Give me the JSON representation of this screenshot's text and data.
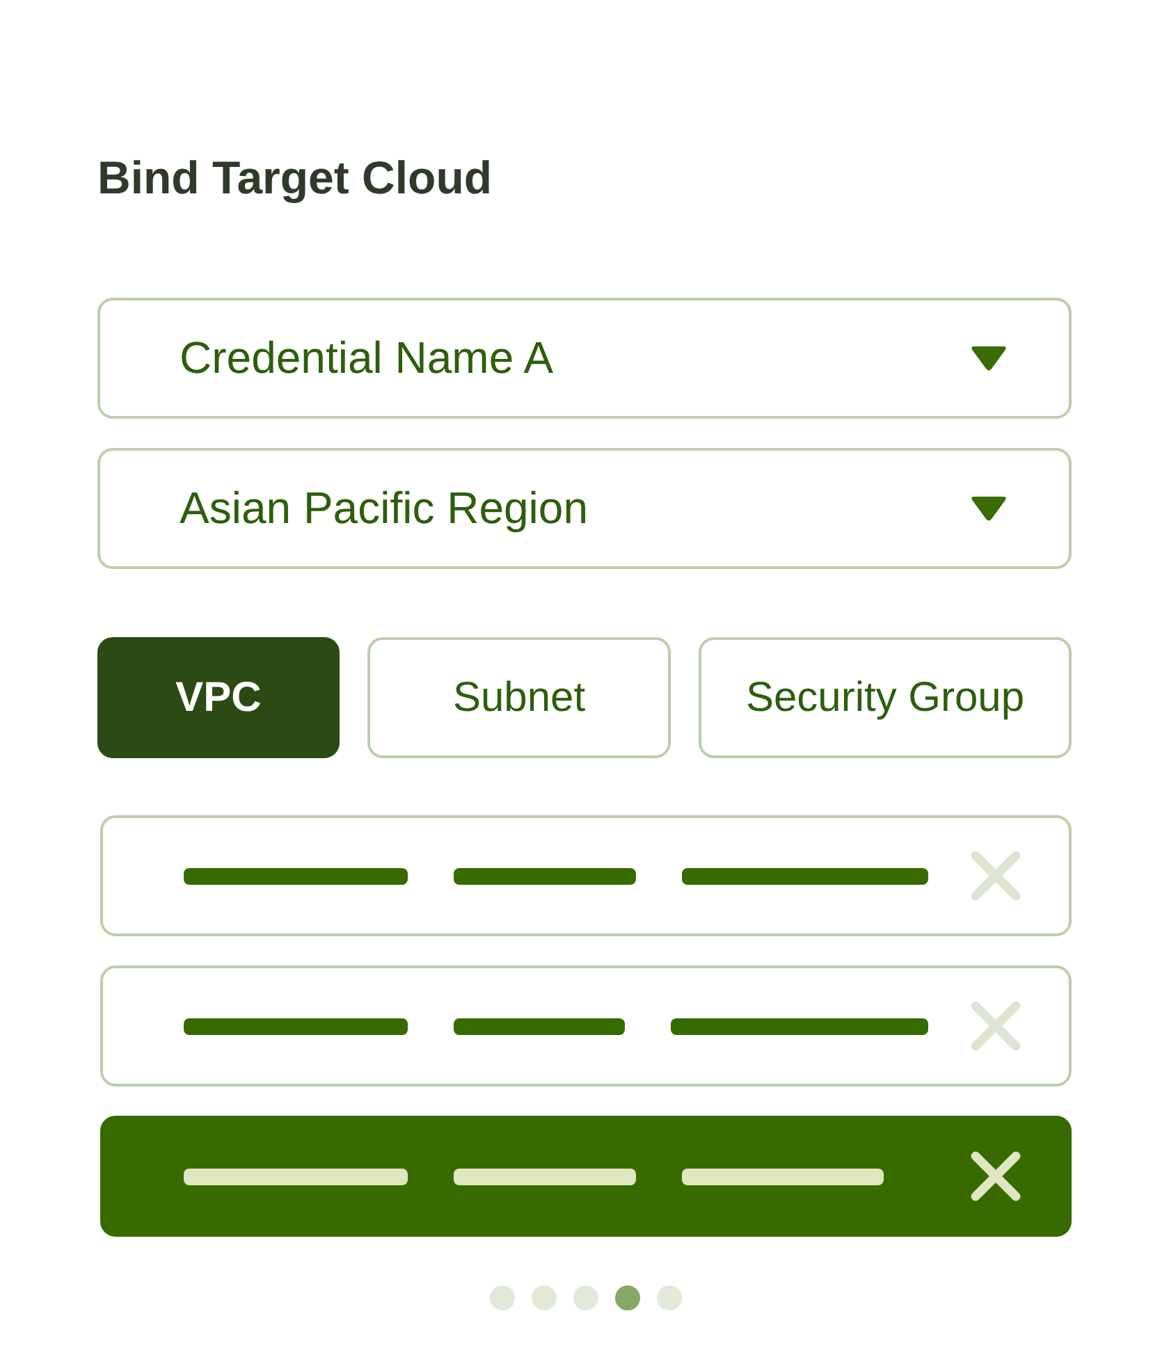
{
  "title": "Bind Target Cloud",
  "dropdowns": [
    {
      "value": "Credential Name A"
    },
    {
      "value": "Asian Pacific Region"
    }
  ],
  "tabs": [
    {
      "label": "VPC",
      "selected": true
    },
    {
      "label": "Subnet",
      "selected": false
    },
    {
      "label": "Security Group",
      "selected": false
    }
  ],
  "rows": [
    {
      "selected": false
    },
    {
      "selected": false
    },
    {
      "selected": true
    }
  ],
  "pagination": [
    {
      "selected": false
    },
    {
      "selected": false
    },
    {
      "selected": false
    },
    {
      "selected": true
    },
    {
      "selected": false
    }
  ]
}
